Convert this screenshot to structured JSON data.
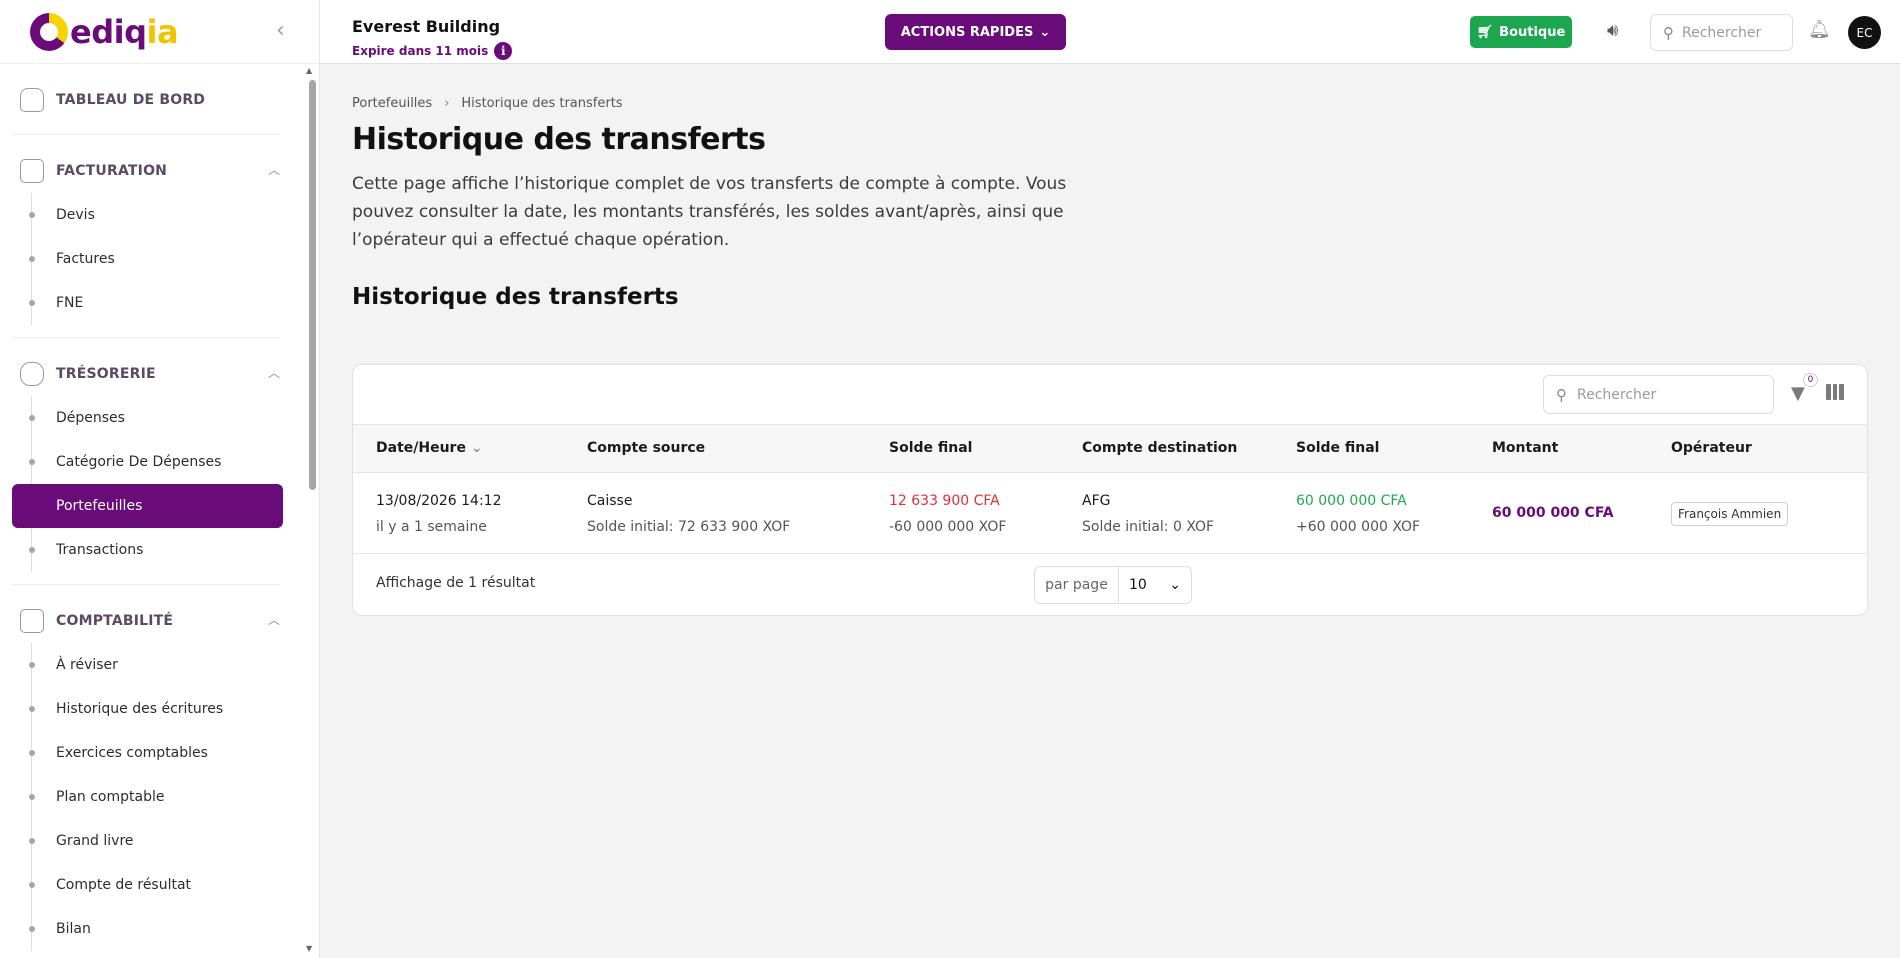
{
  "brand": {
    "logo_text_main": "ediq",
    "logo_text_accent": "ia",
    "primary_color": "#6a0b7a",
    "accent_color": "#f4d300"
  },
  "sidebar": {
    "collapse_icon": "chevron-left-icon",
    "dashboard": {
      "label": "TABLEAU DE BORD",
      "icon": "home-icon"
    },
    "sections": [
      {
        "label": "FACTURATION",
        "icon": "invoice-icon",
        "items": [
          "Devis",
          "Factures",
          "FNE"
        ]
      },
      {
        "label": "TRÉSORERIE",
        "icon": "piggy-bank-icon",
        "items": [
          "Dépenses",
          "Catégorie De Dépenses",
          "Portefeuilles",
          "Transactions"
        ],
        "active": "Portefeuilles"
      },
      {
        "label": "COMPTABILITÉ",
        "icon": "calculator-icon",
        "items": [
          "À réviser",
          "Historique des écritures",
          "Exercices comptables",
          "Plan comptable",
          "Grand livre",
          "Compte de résultat",
          "Bilan"
        ]
      }
    ]
  },
  "topbar": {
    "org_name": "Everest Building",
    "expiry": "Expire dans 11 mois",
    "quick_actions": "ACTIONS RAPIDES",
    "boutique": "Boutique",
    "search_placeholder": "Rechercher",
    "avatar_initials": "EC"
  },
  "breadcrumb": {
    "parent": "Portefeuilles",
    "current": "Historique des transferts"
  },
  "page": {
    "title": "Historique des transferts",
    "description": "Cette page affiche l’historique complet de vos transferts de compte à compte. Vous pouvez consulter la date, les montants transférés, les soldes avant/après, ainsi que l’opérateur qui a effectué chaque opération.",
    "section_title": "Historique des transferts"
  },
  "table": {
    "search_placeholder": "Rechercher",
    "filter_count": "0",
    "columns": [
      "Date/Heure",
      "Compte source",
      "Solde final",
      "Compte destination",
      "Solde final",
      "Montant",
      "Opérateur"
    ],
    "rows": [
      {
        "date": "13/08/2026 14:12",
        "relative": "il y a 1 semaine",
        "source": "Caisse",
        "source_initial": "Solde initial: 72 633 900 XOF",
        "source_final": "12 633 900 CFA",
        "source_delta": "-60 000 000 XOF",
        "dest": "AFG",
        "dest_initial": "Solde initial: 0 XOF",
        "dest_final": "60 000 000 CFA",
        "dest_delta": "+60 000 000 XOF",
        "amount": "60 000 000 CFA",
        "operator": "François Ammien"
      }
    ],
    "result_text": "Affichage de 1 résultat",
    "per_page_label": "par page",
    "per_page_value": "10"
  }
}
